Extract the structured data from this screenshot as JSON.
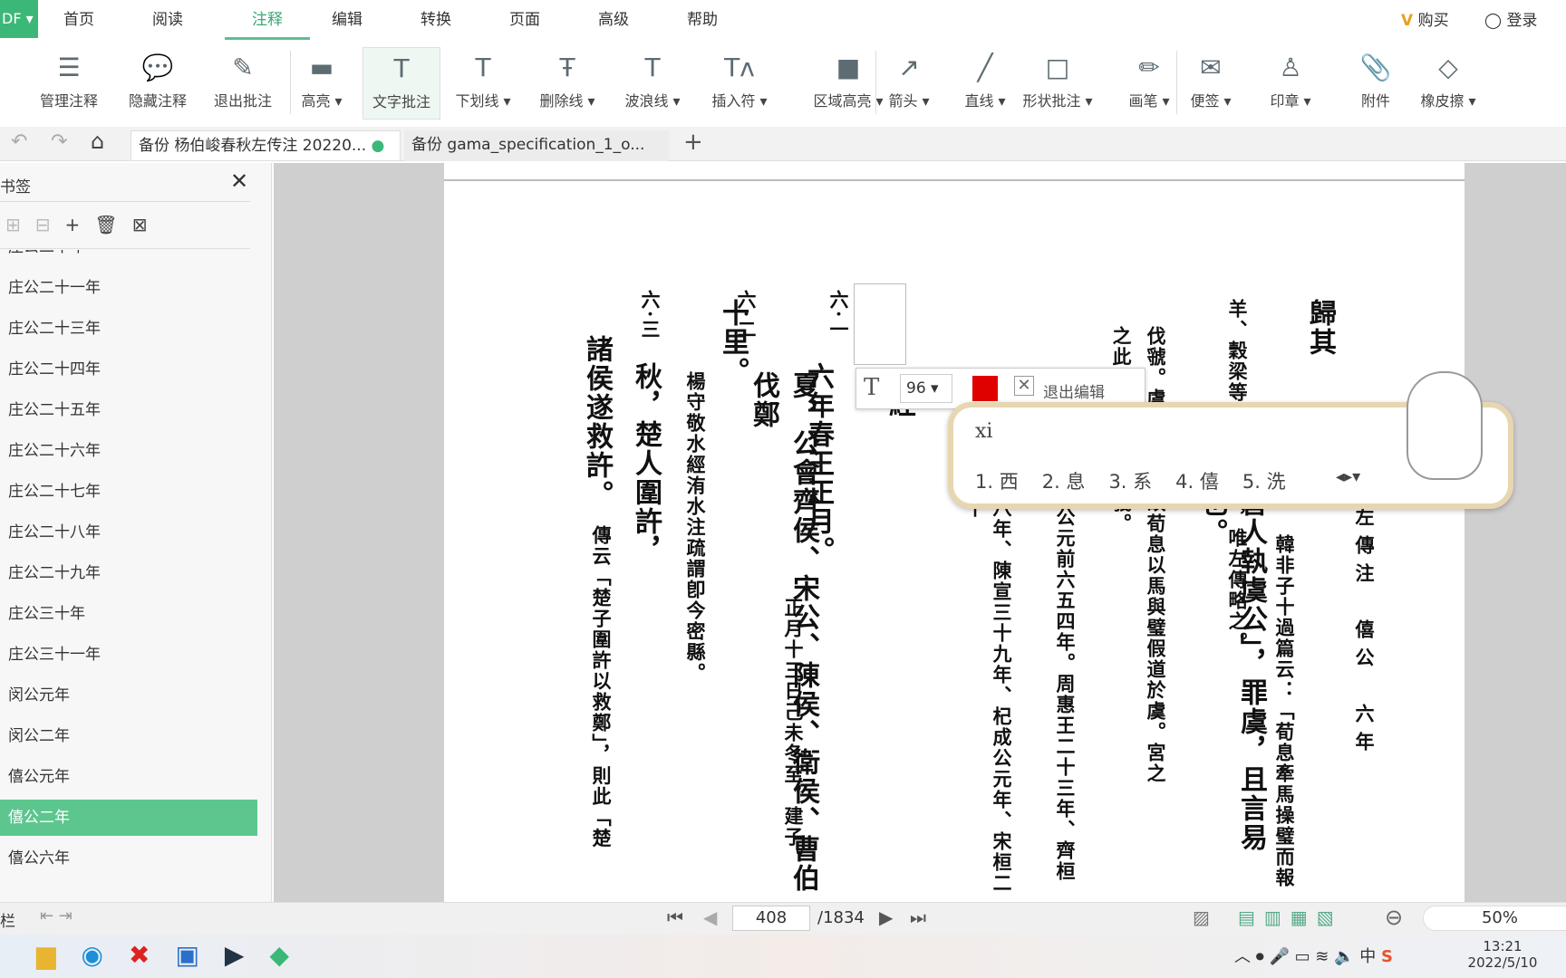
{
  "app": {
    "logo": "DF",
    "menus": [
      "首页",
      "阅读",
      "注释",
      "编辑",
      "转换",
      "页面",
      "高级",
      "帮助"
    ],
    "active_menu": "注释",
    "buy": "购买",
    "login": "登录"
  },
  "toolbar": [
    "管理注释",
    "隐藏注释",
    "退出批注",
    "高亮 ▾",
    "文字批注",
    "下划线 ▾",
    "删除线 ▾",
    "波浪线 ▾",
    "插入符 ▾",
    "区域高亮 ▾",
    "箭头 ▾",
    "直线 ▾",
    "形状批注 ▾",
    "画笔 ▾",
    "便签 ▾",
    "印章 ▾",
    "附件",
    "橡皮擦 ▾"
  ],
  "tabs": [
    {
      "label": "备份 杨伯峻春秋左传注 20220...",
      "modified": true
    },
    {
      "label": "备份 gama_specification_1_o..."
    }
  ],
  "sidebar": {
    "title": "书签",
    "items": [
      "庄公二十年",
      "庄公二十一年",
      "庄公二十三年",
      "庄公二十四年",
      "庄公二十五年",
      "庄公二十六年",
      "庄公二十七年",
      "庄公二十八年",
      "庄公二十九年",
      "庄公三十年",
      "庄公三十一年",
      "闵公元年",
      "闵公二年",
      "僖公元年",
      "僖公二年",
      "僖公六年"
    ],
    "selected": "僖公二年"
  },
  "document": {
    "header": "左傳注　僖公　六年",
    "columns": [
      {
        "text": "歸其",
        "size": "big"
      },
      {
        "text": "韓非子十過篇云：「荀息牽馬操璧而報",
        "size": "small"
      },
      {
        "text": "羊、穀梁等書皆有此言，唯左傳略之。",
        "size": "small"
      },
      {
        "text": "晉人執虞公」，罪虞，且言易也。",
        "size": "big"
      },
      {
        "text": "伐虢。虞之始也，故荀息以馬與璧假道於虞。宮之",
        "size": "small"
      },
      {
        "text": "之此言，卽用左傳義。",
        "size": "small"
      },
      {
        "text": "公元前六五四年。周惠王二十三年、齊桓",
        "size": "small"
      },
      {
        "text": "八年、陳宣三十九年、杞成公元年、宋桓二十",
        "size": "small"
      },
      {
        "text": "經",
        "size": "big"
      },
      {
        "text": "六·一",
        "size": "small"
      },
      {
        "text": "六年春王正月。",
        "size": "big"
      },
      {
        "text": "正月十三日己未冬至，建子。",
        "size": "small"
      },
      {
        "text": "六·二",
        "size": "small"
      },
      {
        "text": "夏，公會齊侯、宋公、陳侯、衛侯、曹伯伐鄭",
        "size": "big"
      },
      {
        "text": "十里。",
        "size": "big"
      },
      {
        "text": "楊守敬水經洧水注疏謂卽今密縣。",
        "size": "small"
      },
      {
        "text": "六·三",
        "size": "small"
      },
      {
        "text": "秋，楚人圍許，",
        "size": "big"
      },
      {
        "text": "傳云「楚子圍許以救鄭」，則此「楚",
        "size": "small"
      },
      {
        "text": "諸侯遂救許。",
        "size": "big"
      }
    ]
  },
  "annotation_bar": {
    "font_size": "96",
    "color": "#e00000",
    "exit": "退出编辑"
  },
  "ime": {
    "input": "xi",
    "candidates": [
      "1. 西",
      "2. 息",
      "3. 系",
      "4. 僖",
      "5. 洗"
    ]
  },
  "status": {
    "left": "栏",
    "page": "408",
    "total": "/1834",
    "zoom": "50%"
  },
  "taskbar": {
    "time": "13:21",
    "date": "2022/5/10",
    "ime_lang": "中"
  }
}
